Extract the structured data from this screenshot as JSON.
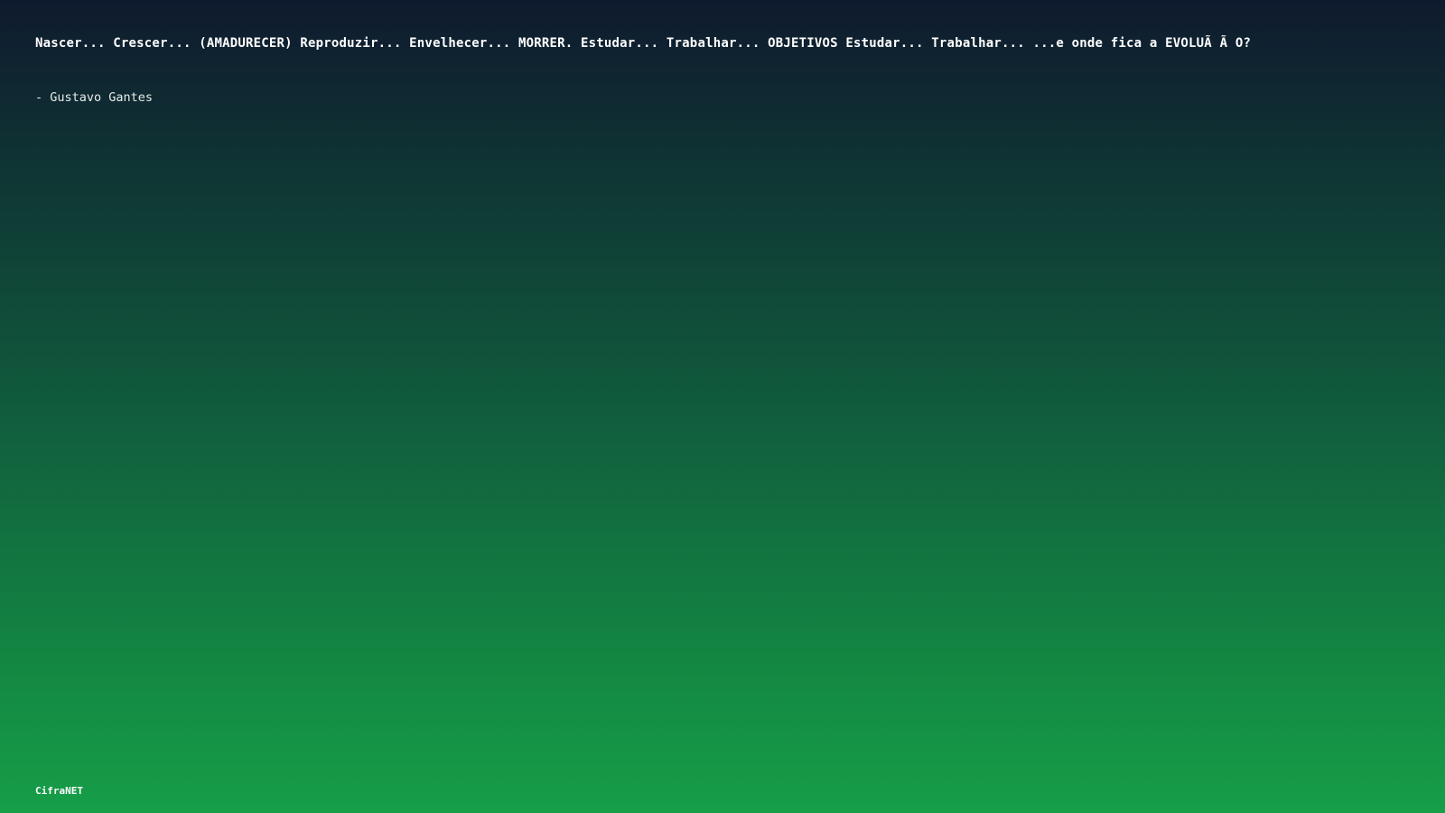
{
  "quote": {
    "text": "Nascer... Crescer... (AMADURECER) Reproduzir... Envelhecer... MORRER. Estudar... Trabalhar... OBJETIVOS Estudar... Trabalhar... ...e onde fica a EVOLUÃ Ã O?",
    "author": "- Gustavo Gantes"
  },
  "footer": {
    "brand": "CifraNET"
  },
  "colors": {
    "gradient_top": "#0f1a2e",
    "gradient_bottom": "#169e48",
    "text": "#ffffff"
  }
}
